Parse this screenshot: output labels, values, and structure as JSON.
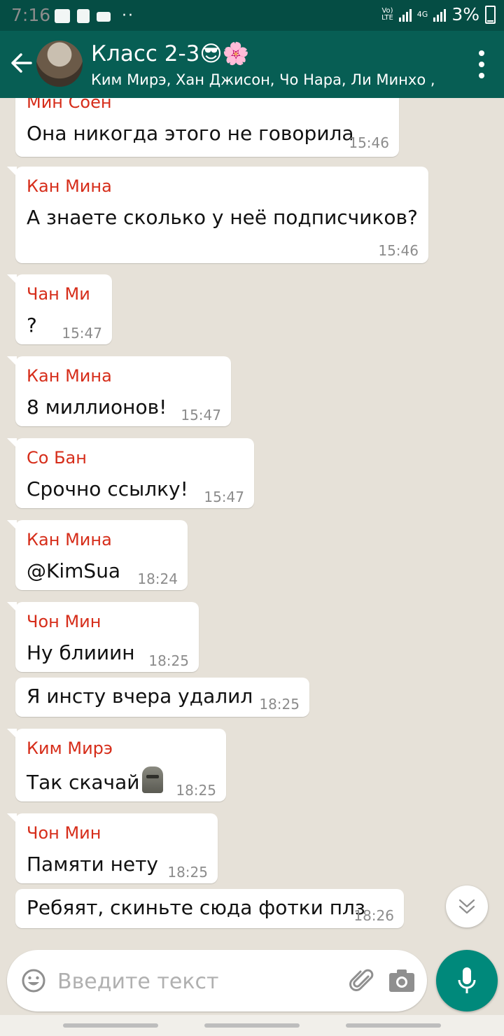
{
  "status_bar": {
    "time": "7:16",
    "volte": "Vo)) LTE",
    "network": "4G",
    "battery": "3%",
    "left_icons": [
      "gallery-icon",
      "facebook-icon",
      "video-icon"
    ]
  },
  "header": {
    "title": "Класс 2-3😎🌸",
    "subtitle": "Ким Мирэ, Хан Джисон, Чо Нара, Ли Минхо ,...",
    "colors": {
      "appbar": "#075e54",
      "statusbar": "#054d44"
    }
  },
  "messages": [
    {
      "sender": "Мин Соён",
      "text": "Она никогда этого не говорила",
      "time": "15:46"
    },
    {
      "sender": "Кан Мина",
      "text": "А знаете сколько у неё подписчиков?",
      "time": "15:46"
    },
    {
      "sender": "Чан Ми",
      "text": "?",
      "time": "15:47"
    },
    {
      "sender": "Кан Мина",
      "text": "8 миллионов!",
      "time": "15:47"
    },
    {
      "sender": "Со Бан",
      "text": "Срочно ссылку!",
      "time": "15:47"
    },
    {
      "sender": "Кан Мина",
      "text": "@KimSua",
      "time": "18:24"
    },
    {
      "sender": "Чон Мин",
      "text": "Ну блииин",
      "time": "18:25"
    },
    {
      "sender": "",
      "text": "Я инсту вчера удалил",
      "time": "18:25"
    },
    {
      "sender": "Ким Мирэ",
      "text": "Так скачай",
      "emoji": "moai",
      "time": "18:25"
    },
    {
      "sender": "Чон Мин",
      "text": "Памяти нету",
      "time": "18:25"
    },
    {
      "sender": "",
      "text": "Ребяят, скиньте сюда фотки плз",
      "time": "18:26"
    }
  ],
  "sender_color": "#d62d1a",
  "composer": {
    "placeholder": "Введите текст",
    "icons": [
      "emoji-icon",
      "paperclip-icon",
      "camera-icon",
      "microphone-icon"
    ],
    "mic_color": "#00897b"
  }
}
